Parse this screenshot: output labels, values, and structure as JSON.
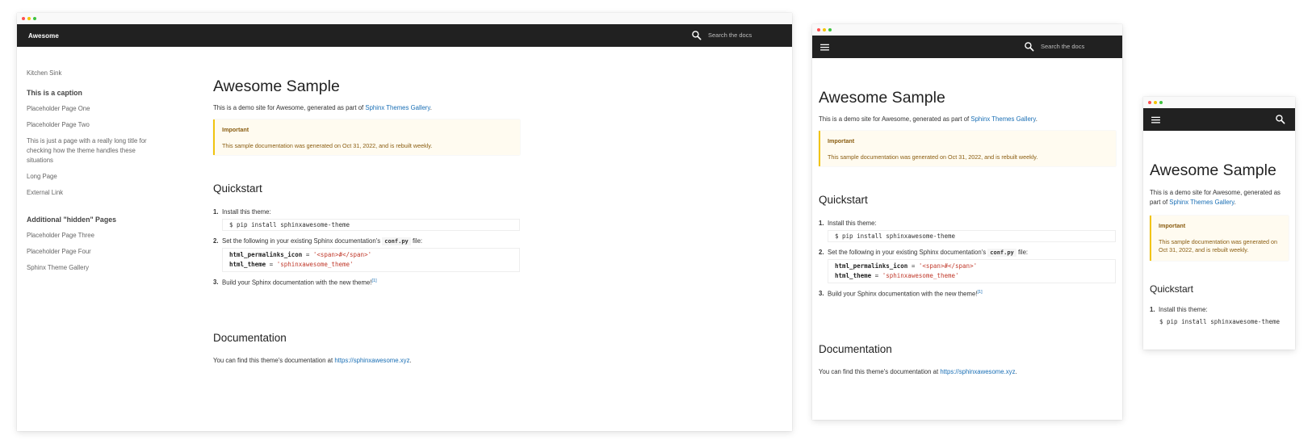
{
  "site": {
    "brand": "Awesome",
    "search_placeholder": "Search the docs"
  },
  "sidebar": {
    "top_item": "Kitchen Sink",
    "caption1": "This is a caption",
    "items1": [
      "Placeholder Page One",
      "Placeholder Page Two",
      "This is just a page with a really long title for checking how the theme handles these situations",
      "Long Page",
      "External Link"
    ],
    "caption2": "Additional \"hidden\" Pages",
    "items2": [
      "Placeholder Page Three",
      "Placeholder Page Four",
      "Sphinx Theme Gallery"
    ]
  },
  "page": {
    "title": "Awesome Sample",
    "intro_prefix": "This is a demo site for Awesome, generated as part of ",
    "intro_link": "Sphinx Themes Gallery",
    "intro_suffix": ".",
    "admonition_title": "Important",
    "admonition_text": "This sample documentation was generated on Oct 31, 2022, and is rebuilt weekly.",
    "quickstart_heading": "Quickstart",
    "step1_num": "1.",
    "step1_text": "Install this theme:",
    "step1_code": "$ pip install sphinxawesome-theme",
    "step2_num": "2.",
    "step2_prefix": "Set the following in your existing Sphinx documentation's ",
    "step2_code_inline": "conf.py",
    "step2_suffix": " file:",
    "code_line1_key": "html_permalinks_icon",
    "code_line1_op": " = ",
    "code_line1_val": "'<span>#</span>'",
    "code_line2_key": "html_theme",
    "code_line2_op": " = ",
    "code_line2_val": "'sphinxawesome_theme'",
    "step3_num": "3.",
    "step3_text": "Build your Sphinx documentation with the new theme!",
    "step3_footnote": "[1]",
    "documentation_heading": "Documentation",
    "doc_prefix": "You can find this theme's documentation at ",
    "doc_link": "https://sphinxawesome.xyz",
    "doc_suffix": "."
  },
  "colors": {
    "navbar": "#212121",
    "link": "#1a6fb5",
    "admonition_border": "#f1c40f",
    "admonition_text": "#8a5d11"
  }
}
